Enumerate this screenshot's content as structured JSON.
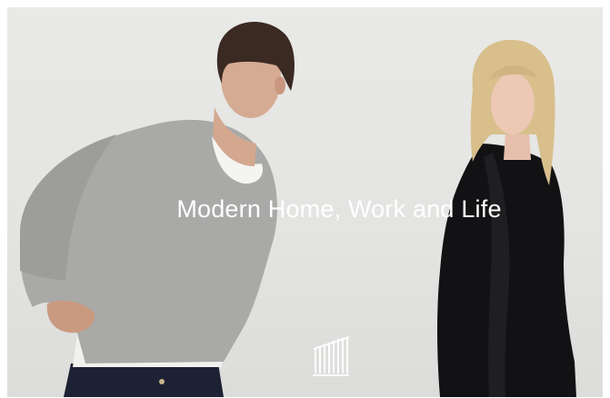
{
  "hero": {
    "headline": "Modern Home, Work and Life",
    "image_subject": "male model in grey sweatshirt and female model in black coat"
  },
  "logo": {
    "icon": "building-columns-logo-icon"
  },
  "colors": {
    "background": "#e6e6e4",
    "headline_text": "#ffffff",
    "sweater": "#a9aaa8",
    "coat": "#121214"
  }
}
